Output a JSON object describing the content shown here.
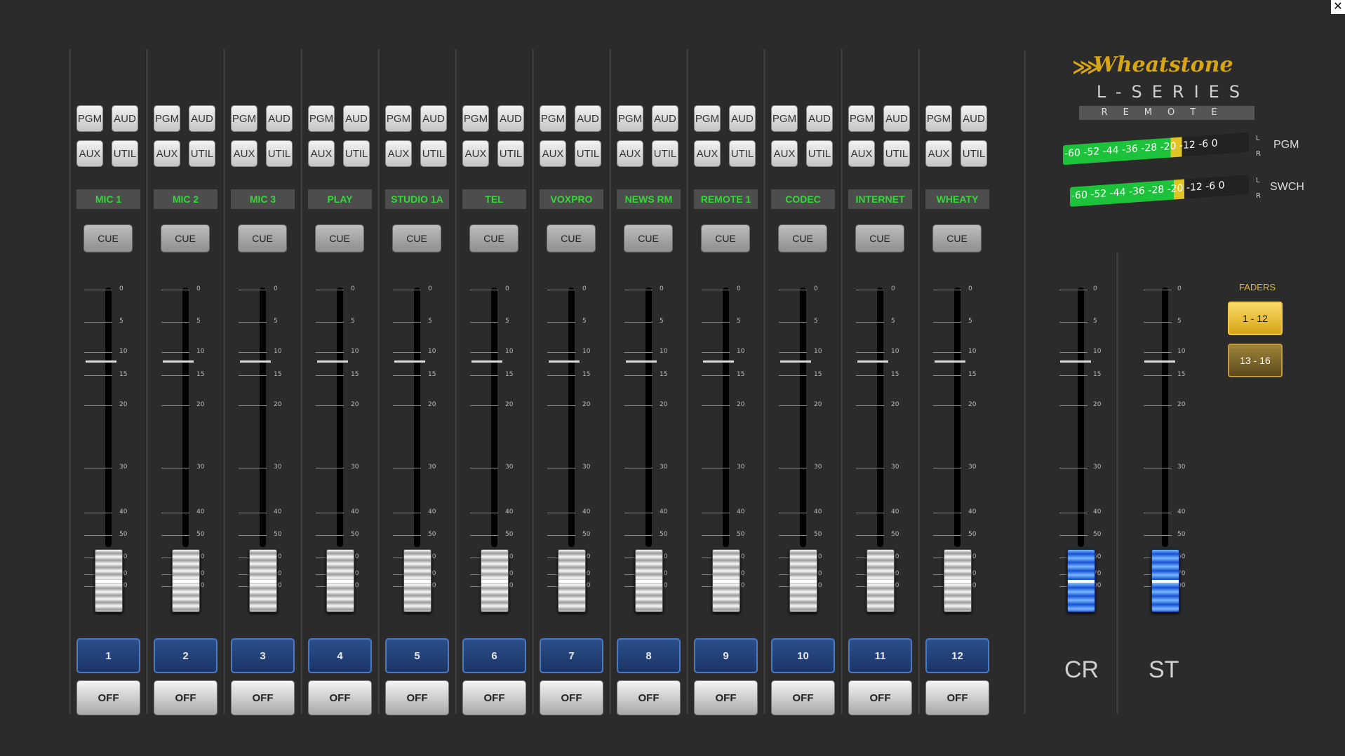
{
  "window": {
    "close_glyph": "✕"
  },
  "logo": {
    "brand": "Wheatstone",
    "series": "L-SERIES",
    "subtitle": "REMOTE",
    "mark": "wing-icon"
  },
  "meters": [
    {
      "name": "PGM",
      "scale": "-60 -52 -44 -36 -28 -20 -12 -6 0",
      "left": "L",
      "right": "R"
    },
    {
      "name": "SWCH",
      "scale": "-60 -52 -44 -36 -28 -20 -12 -6 0",
      "left": "L",
      "right": "R"
    }
  ],
  "strip_buttons": {
    "pgm": "PGM",
    "aud": "AUD",
    "aux": "AUX",
    "util": "UTIL",
    "cue": "CUE",
    "off": "OFF"
  },
  "scale_labels": [
    "0",
    "5",
    "10",
    "15",
    "20",
    "30",
    "40",
    "50",
    "60",
    "70",
    "00"
  ],
  "channels": [
    {
      "number": "1",
      "name": "MIC 1"
    },
    {
      "number": "2",
      "name": "MIC 2"
    },
    {
      "number": "3",
      "name": "MIC 3"
    },
    {
      "number": "4",
      "name": "PLAY"
    },
    {
      "number": "5",
      "name": "STUDIO 1A"
    },
    {
      "number": "6",
      "name": "TEL"
    },
    {
      "number": "7",
      "name": "VOXPRO"
    },
    {
      "number": "8",
      "name": "NEWS RM"
    },
    {
      "number": "9",
      "name": "REMOTE 1"
    },
    {
      "number": "10",
      "name": "CODEC"
    },
    {
      "number": "11",
      "name": "INTERNET"
    },
    {
      "number": "12",
      "name": "WHEATY"
    }
  ],
  "masters": [
    {
      "name": "CR"
    },
    {
      "name": "ST"
    }
  ],
  "faders_panel": {
    "title": "FADERS",
    "banks": [
      "1 - 12",
      "13 - 16"
    ],
    "active_bank": "1 - 12"
  },
  "colors": {
    "background": "#2b2b2b",
    "label_green": "#39d53c",
    "accent_gold": "#d8a514",
    "channel_blue": "#1b3566",
    "master_blue": "#1451d6"
  }
}
